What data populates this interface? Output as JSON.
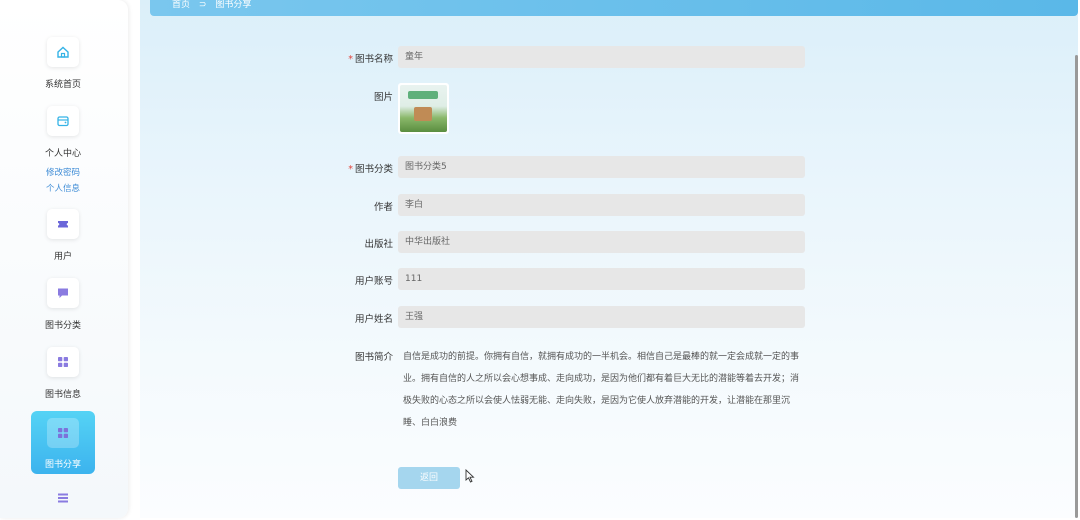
{
  "sidebar": {
    "items": [
      {
        "label": "系统首页",
        "icon": "home-icon"
      },
      {
        "label": "个人中心",
        "icon": "wallet-icon",
        "sub": [
          "修改密码",
          "个人信息"
        ]
      },
      {
        "label": "用户",
        "icon": "ticket-icon"
      },
      {
        "label": "图书分类",
        "icon": "chat-icon"
      },
      {
        "label": "图书信息",
        "icon": "grid-icon"
      },
      {
        "label": "图书分享",
        "icon": "grid-icon",
        "active": true
      },
      {
        "label": "",
        "icon": "menu-icon"
      }
    ],
    "active_color": "#3cb3ee"
  },
  "breadcrumb": {
    "home": "首页",
    "sep": "⊃",
    "current": "图书分享"
  },
  "form": {
    "book_name": {
      "label": "图书名称",
      "value": "童年"
    },
    "image": {
      "label": "图片"
    },
    "category": {
      "label": "图书分类",
      "value": "图书分类5"
    },
    "author": {
      "label": "作者",
      "value": "李白"
    },
    "publisher": {
      "label": "出版社",
      "value": "中华出版社"
    },
    "account": {
      "label": "用户账号",
      "value": "111"
    },
    "username": {
      "label": "用户姓名",
      "value": "王强"
    },
    "intro": {
      "label": "图书简介",
      "value": "自信是成功的前提。你拥有自信，就拥有成功的一半机会。相信自己是最棒的就一定会成就一定的事业。拥有自信的人之所以会心想事成、走向成功，是因为他们都有着巨大无比的潜能等着去开发；消极失败的心态之所以会使人怯弱无能、走向失败，是因为它使人放弃潜能的开发，让潜能在那里沉睡、白白浪费"
    },
    "required_mark": "*",
    "back_button": "返回"
  }
}
